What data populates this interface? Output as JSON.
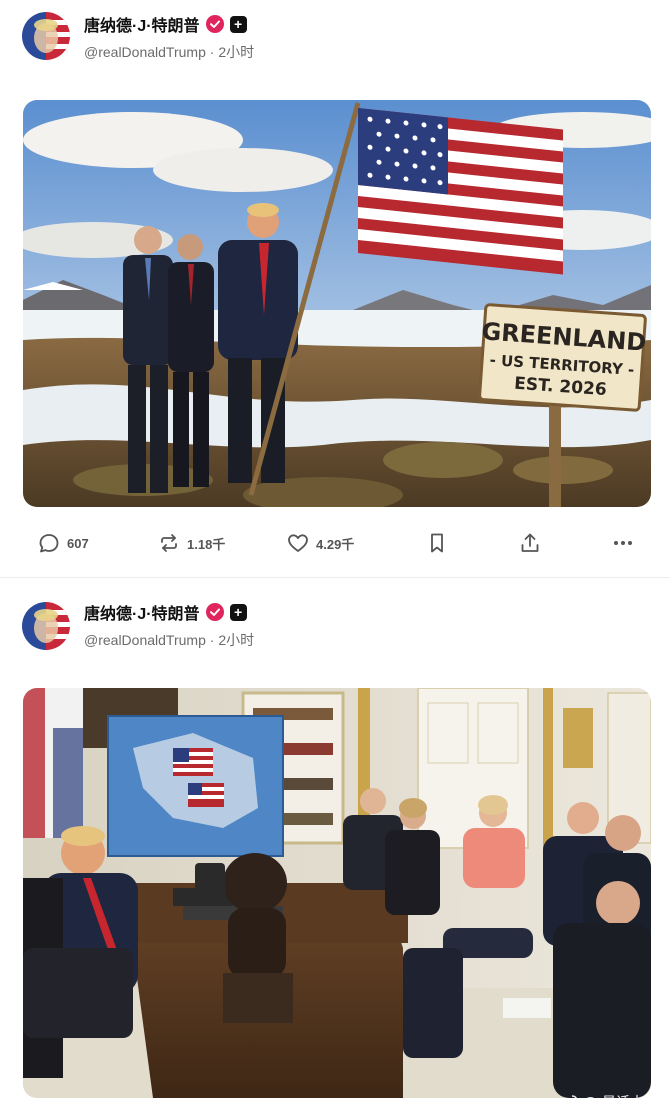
{
  "posts": [
    {
      "author": {
        "name": "唐纳德·J·特朗普",
        "handle": "@realDonaldTrump",
        "time": "2小时",
        "separator": "·"
      },
      "image": {
        "description_icon": "landscape-flag-image-icon",
        "sign_lines": [
          "GREENLAND",
          "- US TERRITORY -",
          "EST. 2026"
        ]
      },
      "actions": {
        "replies": "607",
        "reposts": "1.18千",
        "likes": "4.29千"
      }
    },
    {
      "author": {
        "name": "唐纳德·J·特朗普",
        "handle": "@realDonaldTrump",
        "time": "2小时",
        "separator": "·"
      },
      "image": {
        "description_icon": "oval-office-image-icon"
      }
    }
  ],
  "watermark": {
    "text": "星话大白"
  },
  "colors": {
    "verified": "#e0245e",
    "icon_gray": "#555555",
    "divider": "#ececec"
  }
}
